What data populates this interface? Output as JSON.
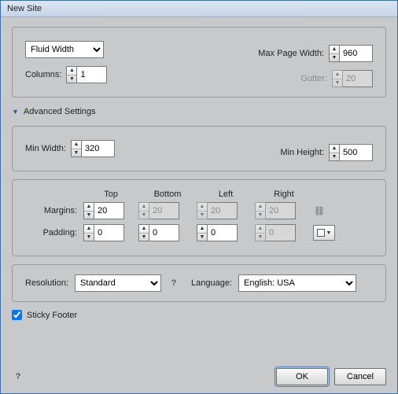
{
  "title": "New Site",
  "layout": {
    "widthMode": "Fluid Width",
    "maxPageWidthLabel": "Max Page Width:",
    "maxPageWidth": "960",
    "columnsLabel": "Columns:",
    "columns": "1",
    "gutterLabel": "Gutter:",
    "gutter": "20"
  },
  "advanced": {
    "heading": "Advanced Settings",
    "minWidthLabel": "Min Width:",
    "minWidth": "320",
    "minHeightLabel": "Min Height:",
    "minHeight": "500"
  },
  "box": {
    "headers": {
      "top": "Top",
      "bottom": "Bottom",
      "left": "Left",
      "right": "Right"
    },
    "marginsLabel": "Margins:",
    "margins": {
      "top": "20",
      "bottom": "20",
      "left": "20",
      "right": "20"
    },
    "paddingLabel": "Padding:",
    "padding": {
      "top": "0",
      "bottom": "0",
      "left": "0",
      "right": "0"
    }
  },
  "settings": {
    "resolutionLabel": "Resolution:",
    "resolution": "Standard",
    "languageLabel": "Language:",
    "language": "English: USA"
  },
  "sticky": {
    "label": "Sticky Footer",
    "checked": true
  },
  "buttons": {
    "ok": "OK",
    "cancel": "Cancel"
  }
}
